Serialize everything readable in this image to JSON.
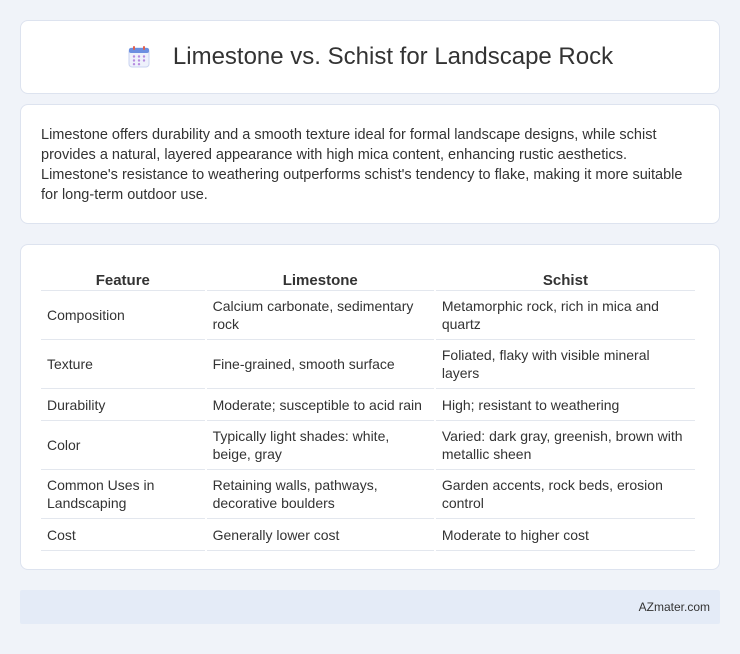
{
  "header": {
    "icon": "calendar-icon",
    "title": "Limestone vs. Schist for Landscape Rock"
  },
  "intro": {
    "text": "Limestone offers durability and a smooth texture ideal for formal landscape designs, while schist provides a natural, layered appearance with high mica content, enhancing rustic aesthetics. Limestone's resistance to weathering outperforms schist's tendency to flake, making it more suitable for long-term outdoor use."
  },
  "table": {
    "headers": [
      "Feature",
      "Limestone",
      "Schist"
    ],
    "rows": [
      [
        "Composition",
        "Calcium carbonate, sedimentary rock",
        "Metamorphic rock, rich in mica and quartz"
      ],
      [
        "Texture",
        "Fine-grained, smooth surface",
        "Foliated, flaky with visible mineral layers"
      ],
      [
        "Durability",
        "Moderate; susceptible to acid rain",
        "High; resistant to weathering"
      ],
      [
        "Color",
        "Typically light shades: white, beige, gray",
        "Varied: dark gray, greenish, brown with metallic sheen"
      ],
      [
        "Common Uses in Landscaping",
        "Retaining walls, pathways, decorative boulders",
        "Garden accents, rock beds, erosion control"
      ],
      [
        "Cost",
        "Generally lower cost",
        "Moderate to higher cost"
      ]
    ]
  },
  "footer": {
    "text": "AZmater.com"
  },
  "colors": {
    "background": "#f0f3f9",
    "card": "#ffffff",
    "footer": "#e4ebf7",
    "icon_accent": "#6c8fe0"
  }
}
